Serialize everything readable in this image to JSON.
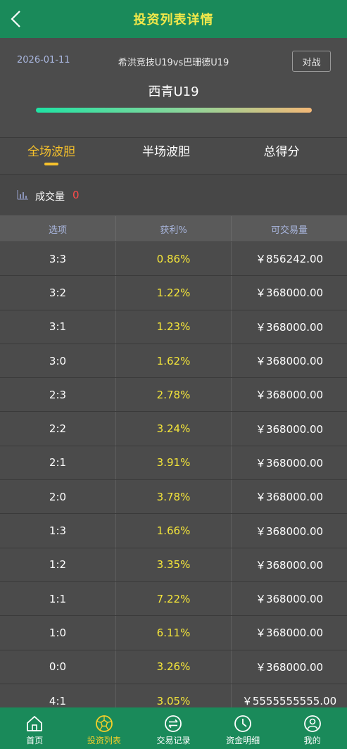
{
  "header": {
    "title": "投资列表详情"
  },
  "match": {
    "date": "2026-01-11",
    "teams": "希洪竞技U19vs巴珊德U19",
    "vs_button": "对战",
    "team": "西青U19"
  },
  "tabs": [
    {
      "label": "全场波胆",
      "active": true
    },
    {
      "label": "半场波胆",
      "active": false
    },
    {
      "label": "总得分",
      "active": false
    }
  ],
  "volume": {
    "label": "成交量",
    "value": "0"
  },
  "table": {
    "headers": [
      "选项",
      "获利%",
      "可交易量"
    ],
    "rows": [
      {
        "option": "3:3",
        "profit": "0.86%",
        "amount": "￥856242.00"
      },
      {
        "option": "3:2",
        "profit": "1.22%",
        "amount": "￥368000.00"
      },
      {
        "option": "3:1",
        "profit": "1.23%",
        "amount": "￥368000.00"
      },
      {
        "option": "3:0",
        "profit": "1.62%",
        "amount": "￥368000.00"
      },
      {
        "option": "2:3",
        "profit": "2.78%",
        "amount": "￥368000.00"
      },
      {
        "option": "2:2",
        "profit": "3.24%",
        "amount": "￥368000.00"
      },
      {
        "option": "2:1",
        "profit": "3.91%",
        "amount": "￥368000.00"
      },
      {
        "option": "2:0",
        "profit": "3.78%",
        "amount": "￥368000.00"
      },
      {
        "option": "1:3",
        "profit": "1.66%",
        "amount": "￥368000.00"
      },
      {
        "option": "1:2",
        "profit": "3.35%",
        "amount": "￥368000.00"
      },
      {
        "option": "1:1",
        "profit": "7.22%",
        "amount": "￥368000.00"
      },
      {
        "option": "1:0",
        "profit": "6.11%",
        "amount": "￥368000.00"
      },
      {
        "option": "0:0",
        "profit": "3.26%",
        "amount": "￥368000.00"
      },
      {
        "option": "4:1",
        "profit": "3.05%",
        "amount": "￥5555555555.00"
      }
    ]
  },
  "nav": [
    {
      "label": "首页",
      "icon": "home-icon",
      "active": false
    },
    {
      "label": "投资列表",
      "icon": "football-icon",
      "active": true
    },
    {
      "label": "交易记录",
      "icon": "exchange-icon",
      "active": false
    },
    {
      "label": "资金明细",
      "icon": "clock-icon",
      "active": false
    },
    {
      "label": "我的",
      "icon": "user-icon",
      "active": false
    }
  ],
  "colors": {
    "brand": "#1a8a5a",
    "accent": "#f6c12c",
    "profit": "#f5e63a",
    "volume_value": "#ff4b4b"
  }
}
